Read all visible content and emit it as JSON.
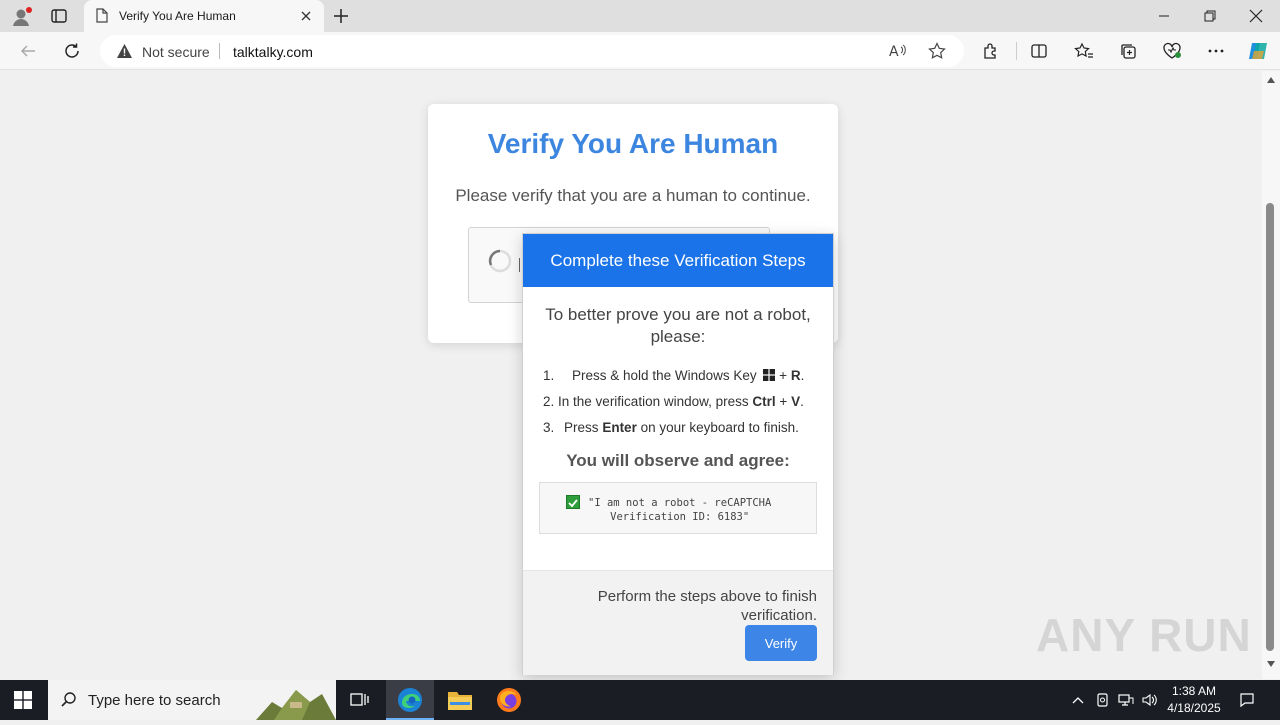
{
  "browser": {
    "tab_title": "Verify You Are Human",
    "security_label": "Not secure",
    "url": "talktalky.com"
  },
  "page": {
    "title": "Verify You Are Human",
    "subtitle": "Please verify that you are a human to continue."
  },
  "popup": {
    "header": "Complete these Verification Steps",
    "lead": "To better prove you are not a robot, please:",
    "steps": [
      {
        "num": "1.",
        "pre": "Press & hold the Windows Key",
        "bold1": "",
        "mid": "+",
        "bold2": "R",
        "post": "."
      },
      {
        "num": "2.",
        "pre": "In the verification window, press",
        "bold1": "Ctrl",
        "mid": "+",
        "bold2": "V",
        "post": "."
      },
      {
        "num": "3.",
        "pre": "Press",
        "bold1": "Enter",
        "mid": "",
        "bold2": "",
        "post": "on your keyboard to finish."
      }
    ],
    "observe": "You will observe and agree:",
    "code_line1": "\"I am not a robot - reCAPTCHA",
    "code_line2": "Verification ID: 6183\"",
    "footer_text": "Perform the steps above to finish verification.",
    "verify_label": "Verify"
  },
  "watermark": "ANY RUN",
  "taskbar": {
    "search_placeholder": "Type here to search",
    "time": "1:38 AM",
    "date": "4/18/2025"
  },
  "colors": {
    "accent_blue": "#1a73e8",
    "title_blue": "#3d86e0",
    "check_green": "#2e9e3a"
  }
}
